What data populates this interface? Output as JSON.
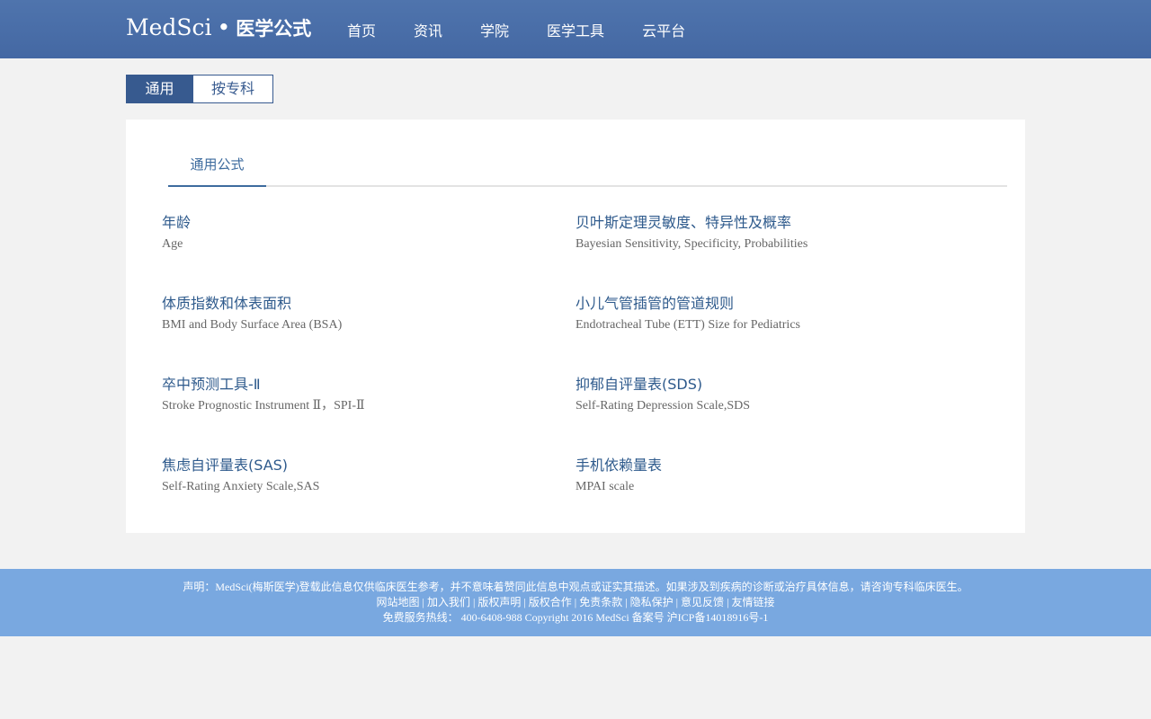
{
  "header": {
    "logo_en": "MedSci",
    "logo_dot": "•",
    "logo_cn": "医学公式",
    "nav": [
      "首页",
      "资讯",
      "学院",
      "医学工具",
      "云平台"
    ]
  },
  "tabs": {
    "general": "通用",
    "by_specialty": "按专科"
  },
  "card": {
    "subtab": "通用公式",
    "formulas": [
      {
        "cn": "年龄",
        "en": "Age"
      },
      {
        "cn": "贝叶斯定理灵敏度、特异性及概率",
        "en": "Bayesian Sensitivity, Specificity, Probabilities"
      },
      {
        "cn": "体质指数和体表面积",
        "en": "BMI and Body Surface Area (BSA)"
      },
      {
        "cn": "小儿气管插管的管道规则",
        "en": "Endotracheal Tube (ETT) Size for Pediatrics"
      },
      {
        "cn": "卒中预测工具-Ⅱ",
        "en": "Stroke Prognostic Instrument Ⅱ，SPI-Ⅱ"
      },
      {
        "cn": "抑郁自评量表(SDS)",
        "en": "Self-Rating Depression Scale,SDS"
      },
      {
        "cn": "焦虑自评量表(SAS)",
        "en": "Self-Rating Anxiety Scale,SAS"
      },
      {
        "cn": "手机依赖量表",
        "en": "MPAI scale"
      }
    ]
  },
  "footer": {
    "statement": "声明：MedSci(梅斯医学)登载此信息仅供临床医生参考，并不意味着赞同此信息中观点或证实其描述。如果涉及到疾病的诊断或治疗具体信息，请咨询专科临床医生。",
    "links": [
      "网站地图",
      "加入我们",
      "版权声明",
      "版权合作",
      "免责条款",
      "隐私保护",
      "意见反馈",
      "友情链接"
    ],
    "separator": " | ",
    "hotline": "免费服务热线： 400-6408-988 Copyright 2016 MedSci 备案号 沪ICP备14018916号-1"
  },
  "colors": {
    "header_bg": "#4a6ea8",
    "accent": "#375a8f",
    "link": "#2e5a8c",
    "footer_bg": "#79a8e0"
  }
}
